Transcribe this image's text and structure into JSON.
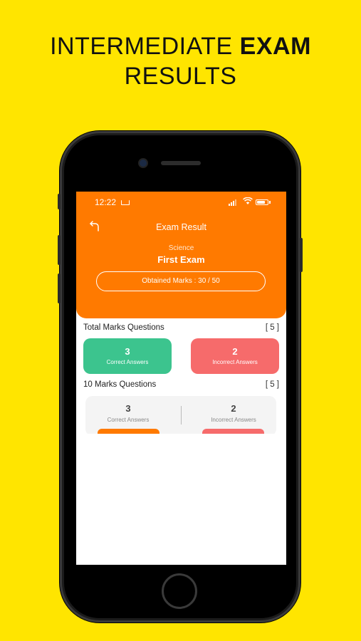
{
  "promo": {
    "headline_pre": "INTERMEDIATE ",
    "headline_bold": "EXAM",
    "headline_line2": "RESULTS"
  },
  "status": {
    "time": "12:22"
  },
  "header": {
    "title": "Exam Result",
    "subject": "Science",
    "exam_name": "First Exam",
    "obtained_label": "Obtained Marks :  30 / 50"
  },
  "total_section": {
    "title": "Total Marks Questions",
    "count": "[ 5 ]",
    "correct": {
      "value": "3",
      "label": "Correct Answers"
    },
    "incorrect": {
      "value": "2",
      "label": "Incorrect Answers"
    }
  },
  "ten_section": {
    "title": "10 Marks Questions",
    "count": "[ 5 ]",
    "correct": {
      "value": "3",
      "label": "Correct Answers"
    },
    "incorrect": {
      "value": "2",
      "label": "Incorrect Answers"
    }
  },
  "colors": {
    "background": "#FFE500",
    "primary": "#FF7A00",
    "correct": "#3CC48E",
    "incorrect": "#F66B6B"
  },
  "icons": {
    "back": "back-arrow-icon",
    "wifi": "wifi-icon",
    "battery": "battery-icon",
    "signal": "signal-icon"
  }
}
